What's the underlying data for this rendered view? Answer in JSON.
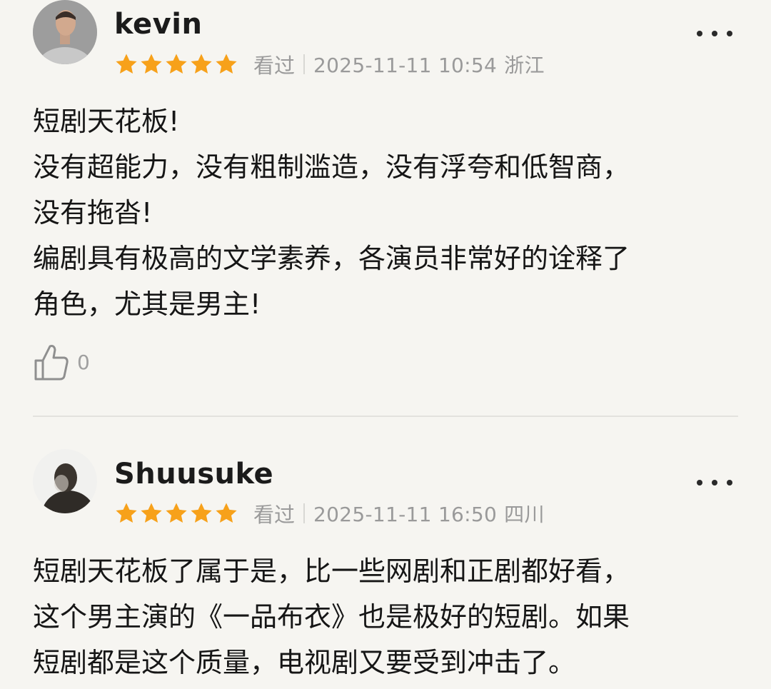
{
  "reviews": [
    {
      "username": "kevin",
      "rating": 5,
      "rating_max": 5,
      "status": "看过",
      "datetime": "2025-11-11 10:54",
      "location": "浙江",
      "lines": [
        "短剧天花板!",
        "没有超能力，没有粗制滥造，没有浮夸和低智商，",
        "没有拖沓!",
        "编剧具有极高的文学素养，各演员非常好的诠释了",
        "角色，尤其是男主!"
      ],
      "likes": "0"
    },
    {
      "username": "Shuusuke",
      "rating": 5,
      "rating_max": 5,
      "status": "看过",
      "datetime": "2025-11-11 16:50",
      "location": "四川",
      "lines": [
        "短剧天花板了属于是，比一些网剧和正剧都好看，",
        "这个男主演的《一品布衣》也是极好的短剧。如果",
        "短剧都是这个质量，电视剧又要受到冲击了。"
      ]
    }
  ],
  "colors": {
    "background": "#f6f5f1",
    "star": "#f7a11a",
    "meta_text": "#9a9a9a",
    "body_text": "#161616"
  },
  "icons": {
    "star": "star-icon",
    "more": "more-dots-icon",
    "like": "thumbs-up-icon"
  }
}
